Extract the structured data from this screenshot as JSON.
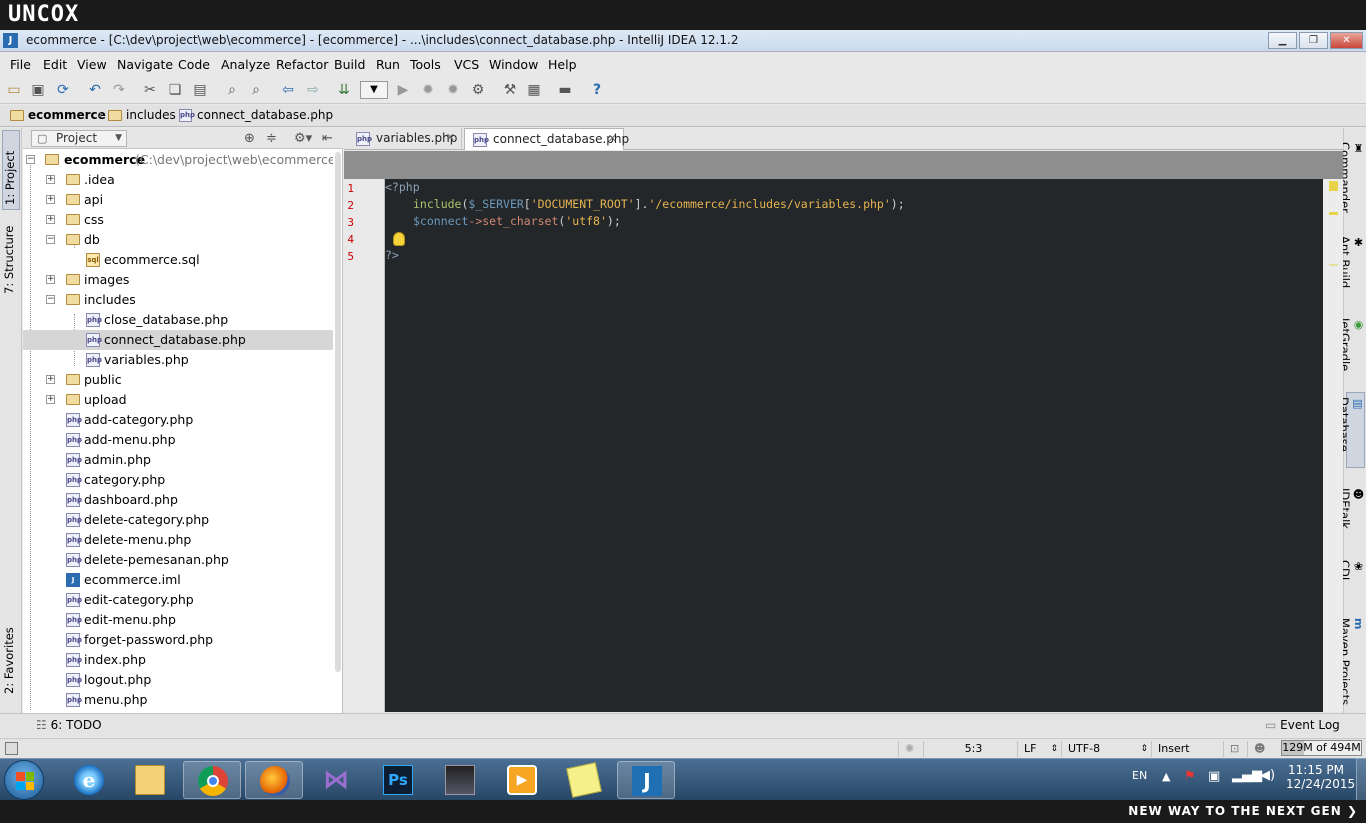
{
  "brand": {
    "logo": "UNCOX",
    "tagline": "NEW WAY TO THE NEXT GEN ❯"
  },
  "window": {
    "title": "ecommerce - [C:\\dev\\project\\web\\ecommerce] - [ecommerce] - ...\\includes\\connect_database.php - IntelliJ IDEA 12.1.2",
    "icon": "J"
  },
  "menu": [
    "File",
    "Edit",
    "View",
    "Navigate",
    "Code",
    "Analyze",
    "Refactor",
    "Build",
    "Run",
    "Tools",
    "VCS",
    "Window",
    "Help"
  ],
  "toolbar_icons": [
    "open-icon",
    "save-icon",
    "sync-icon",
    "undo-icon",
    "redo-icon",
    "cut-icon",
    "copy-icon",
    "paste-icon",
    "find-icon",
    "replace-icon",
    "back-icon",
    "forward-icon",
    "make-icon",
    "run-config-dropdown",
    "run-icon",
    "debug-icon",
    "coverage-icon",
    "attach-icon",
    "settings-icon",
    "structure-icon",
    "terminal-icon",
    "help-icon"
  ],
  "breadcrumb": [
    "ecommerce",
    "includes",
    "connect_database.php"
  ],
  "left_tabs": [
    "1: Project",
    "7: Structure",
    "2: Favorites"
  ],
  "right_tabs": [
    "Commander",
    "Ant Build",
    "JetGradle",
    "Database",
    "IDEtalk",
    "CDI",
    "Maven Projects"
  ],
  "project": {
    "view_selector": "Project",
    "root_name": "ecommerce",
    "root_path": "(C:\\dev\\project\\web\\ecommerce)",
    "items": [
      {
        "name": ".idea",
        "type": "folder"
      },
      {
        "name": "api",
        "type": "folder"
      },
      {
        "name": "css",
        "type": "folder"
      },
      {
        "name": "db",
        "type": "folder"
      },
      {
        "name": "ecommerce.sql",
        "type": "sql"
      },
      {
        "name": "images",
        "type": "folder"
      },
      {
        "name": "includes",
        "type": "folder"
      },
      {
        "name": "close_database.php",
        "type": "php"
      },
      {
        "name": "connect_database.php",
        "type": "php"
      },
      {
        "name": "variables.php",
        "type": "php"
      },
      {
        "name": "public",
        "type": "folder"
      },
      {
        "name": "upload",
        "type": "folder"
      },
      {
        "name": "add-category.php",
        "type": "php"
      },
      {
        "name": "add-menu.php",
        "type": "php"
      },
      {
        "name": "admin.php",
        "type": "php"
      },
      {
        "name": "category.php",
        "type": "php"
      },
      {
        "name": "dashboard.php",
        "type": "php"
      },
      {
        "name": "delete-category.php",
        "type": "php"
      },
      {
        "name": "delete-menu.php",
        "type": "php"
      },
      {
        "name": "delete-pemesanan.php",
        "type": "php"
      },
      {
        "name": "ecommerce.iml",
        "type": "iml"
      },
      {
        "name": "edit-category.php",
        "type": "php"
      },
      {
        "name": "edit-menu.php",
        "type": "php"
      },
      {
        "name": "forget-password.php",
        "type": "php"
      },
      {
        "name": "index.php",
        "type": "php"
      },
      {
        "name": "logout.php",
        "type": "php"
      },
      {
        "name": "menu.php",
        "type": "php"
      }
    ]
  },
  "editor": {
    "tabs": [
      {
        "label": "variables.php"
      },
      {
        "label": "connect_database.php"
      }
    ],
    "line_numbers": [
      "1",
      "2",
      "3",
      "4",
      "5"
    ],
    "code": {
      "l1_open": "<?php",
      "l2_include": "include",
      "l2_paren": "(",
      "l2_server": "$_SERVER",
      "l2_br1": "[",
      "l2_key": "'DOCUMENT_ROOT'",
      "l2_br2": "].",
      "l2_path": "'/ecommerce/includes/variables.php'",
      "l2_end": ");",
      "l3_var": "$connect",
      "l3_arrow": "->",
      "l3_fn": "set_charset",
      "l3_paren": "(",
      "l3_str": "'utf8'",
      "l3_end": ");",
      "l5_close": "?>"
    }
  },
  "bottom": {
    "todo": "6: TODO",
    "event_log": "Event Log"
  },
  "status": {
    "position": "5:3",
    "line_sep": "LF",
    "encoding": "UTF-8",
    "mode": "Insert",
    "memory": "129M of 494M"
  },
  "taskbar": {
    "apps": [
      "Internet Explorer",
      "File Explorer",
      "Google Chrome",
      "Firefox",
      "Visual Studio",
      "Photoshop",
      "PES",
      "Media Player",
      "Sticky Notes",
      "IntelliJ IDEA"
    ],
    "lang": "EN",
    "time": "11:15 PM",
    "date": "12/24/2015"
  }
}
